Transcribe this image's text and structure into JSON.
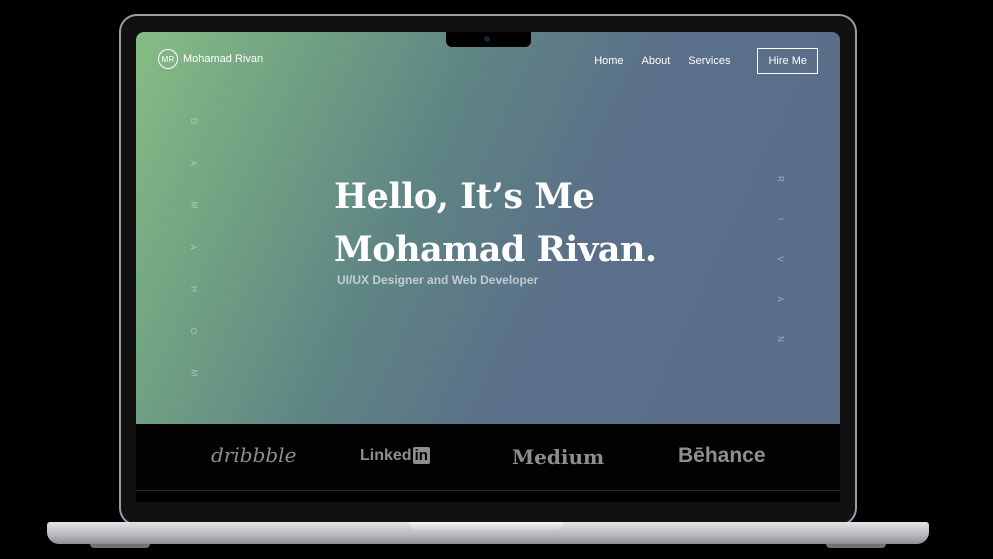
{
  "brand": {
    "initials": "MR",
    "name": "Mohamad Rivan"
  },
  "nav": {
    "items": [
      "Home",
      "About",
      "Services"
    ],
    "cta": "Hire Me"
  },
  "hero": {
    "headline_line1": "Hello, It’s Me",
    "headline_line2": "Mohamad Rivan.",
    "subtitle": "UI/UX Designer and Web Developer",
    "vertical_left": [
      "D",
      "A",
      "M",
      "A",
      "H",
      "O",
      "M"
    ],
    "vertical_right": [
      "R",
      "I",
      "V",
      "A",
      "N"
    ]
  },
  "logos": {
    "dribbble": "dribbble",
    "linkedin_text": "Linked",
    "linkedin_box": "in",
    "medium": "Medium",
    "behance": "Bēhance"
  },
  "colors": {
    "gradient_start": "#86bd84",
    "gradient_end": "#5a6e8a",
    "logo_gray": "#8e8e8e"
  }
}
